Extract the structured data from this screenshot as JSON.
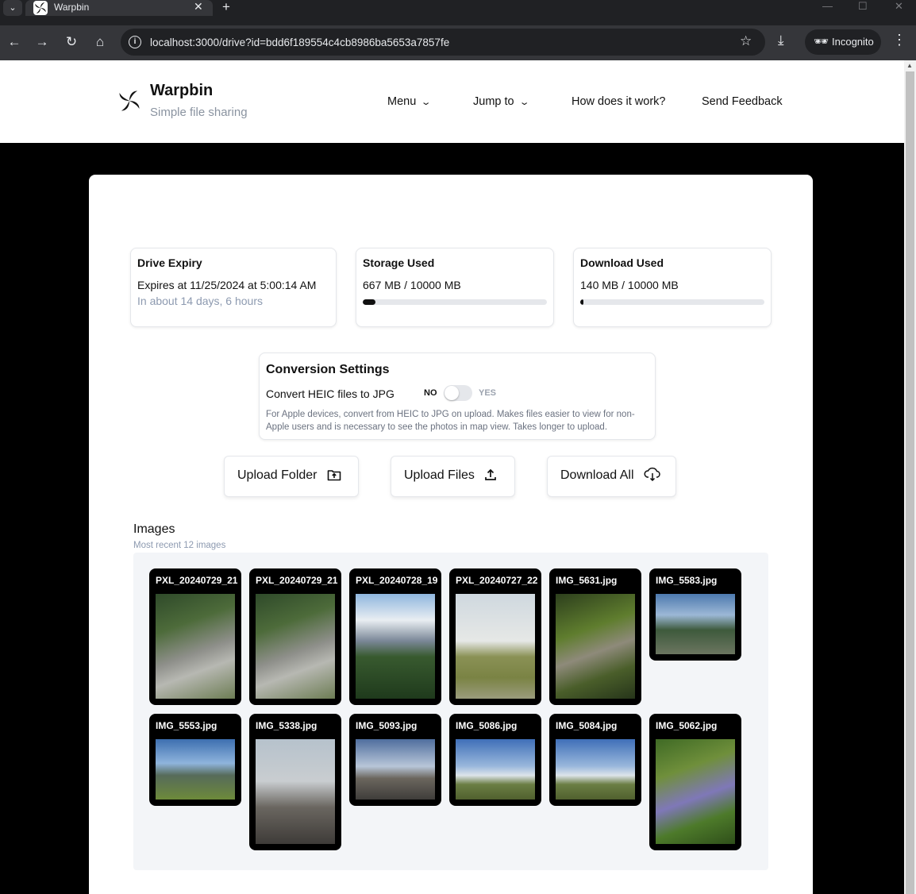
{
  "browser": {
    "tab_title": "Warpbin",
    "url": "localhost:3000/drive?id=bdd6f189554c4cb8986ba5653a7857fe",
    "incognito_label": "Incognito"
  },
  "site": {
    "name": "Warpbin",
    "tagline": "Simple file sharing",
    "nav": {
      "menu": "Menu",
      "jump_to": "Jump to",
      "how": "How does it work?",
      "feedback": "Send Feedback"
    }
  },
  "stats": {
    "expiry": {
      "title": "Drive Expiry",
      "value": "Expires at 11/25/2024 at 5:00:14 AM",
      "relative": "In about 14 days, 6 hours"
    },
    "storage": {
      "title": "Storage Used",
      "value": "667 MB / 10000 MB",
      "fraction": 0.0667
    },
    "download": {
      "title": "Download Used",
      "value": "140 MB / 10000 MB",
      "fraction": 0.014
    }
  },
  "conversion": {
    "title": "Conversion Settings",
    "label": "Convert HEIC files to JPG",
    "no": "NO",
    "yes": "YES",
    "enabled": false,
    "description": "For Apple devices, convert from HEIC to JPG on upload. Makes files easier to view for non-Apple users and is necessary to see the photos in map view. Takes longer to upload."
  },
  "actions": {
    "upload_folder": "Upload Folder",
    "upload_files": "Upload Files",
    "download_all": "Download All"
  },
  "images": {
    "heading": "Images",
    "subheading": "Most recent 12 images",
    "items": [
      {
        "name": "PXL_20240729_21"
      },
      {
        "name": "PXL_20240729_21"
      },
      {
        "name": "PXL_20240728_19"
      },
      {
        "name": "PXL_20240727_22"
      },
      {
        "name": "IMG_5631.jpg"
      },
      {
        "name": "IMG_5583.jpg"
      },
      {
        "name": "IMG_5553.jpg"
      },
      {
        "name": "IMG_5338.jpg"
      },
      {
        "name": "IMG_5093.jpg"
      },
      {
        "name": "IMG_5086.jpg"
      },
      {
        "name": "IMG_5084.jpg"
      },
      {
        "name": "IMG_5062.jpg"
      }
    ]
  }
}
